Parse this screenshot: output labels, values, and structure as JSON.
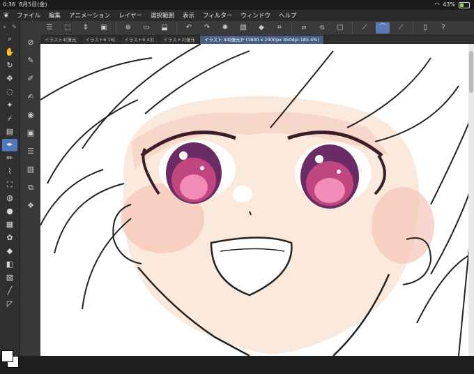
{
  "status": {
    "time": "0:36",
    "date": "8月5日(金)",
    "battery": "43%",
    "battery_fill": 0.43
  },
  "menu": {
    "items": [
      "ファイル",
      "編集",
      "アニメーション",
      "レイヤー",
      "選択範囲",
      "表示",
      "フィルター",
      "ウィンドウ",
      "ヘルプ"
    ]
  },
  "toolbar": {
    "icons": [
      "menu-icon",
      "transform-icon",
      "stepper-icon",
      "snapshot-icon",
      "new-file-icon",
      "open-folder-icon",
      "save-icon",
      "undo-icon",
      "redo-icon",
      "loading-icon",
      "clear-icon",
      "fill-icon",
      "crop-icon",
      "ruler-icon",
      "snap-ruler-icon",
      "snap-grid-icon",
      "pen-snap-icon",
      "pen-curve-icon",
      "pen-line-icon",
      "tablet-icon",
      "help-icon"
    ]
  },
  "tabs": [
    {
      "label": "イラスト4[復元"
    },
    {
      "label": "イラスト6 16["
    },
    {
      "label": "イラスト6 43["
    },
    {
      "label": "イラスト2[復元"
    },
    {
      "label": "イラスト 44[復元]* (1800 x 2400px 350dpi 185.4%)",
      "active": true
    }
  ],
  "tools": [
    "zoom-icon",
    "hand-icon",
    "rotate-icon",
    "move-icon",
    "lasso-icon",
    "magic-wand-icon",
    "eyedropper-icon",
    "frame-icon",
    "pen-icon",
    "pencil-icon",
    "brush-icon",
    "airbrush-icon",
    "blend-icon",
    "watercolor-icon",
    "pattern-icon",
    "decoration-icon",
    "eraser-icon",
    "fill-icon",
    "gradient-icon",
    "line-icon",
    "ruler-icon"
  ],
  "subtools": [
    "close-icon",
    "pen-sub-icon",
    "marker-icon",
    "ink-icon",
    "layer-icon",
    "grid-icon",
    "list-icon",
    "table-icon",
    "stack-icon",
    "layers-icon"
  ],
  "colors": {
    "accent": "#4e78b8",
    "tab_active": "#4a5f85",
    "skin": "#fbe9da",
    "blush": "#f4b7ae",
    "iris": "#c0467f"
  }
}
